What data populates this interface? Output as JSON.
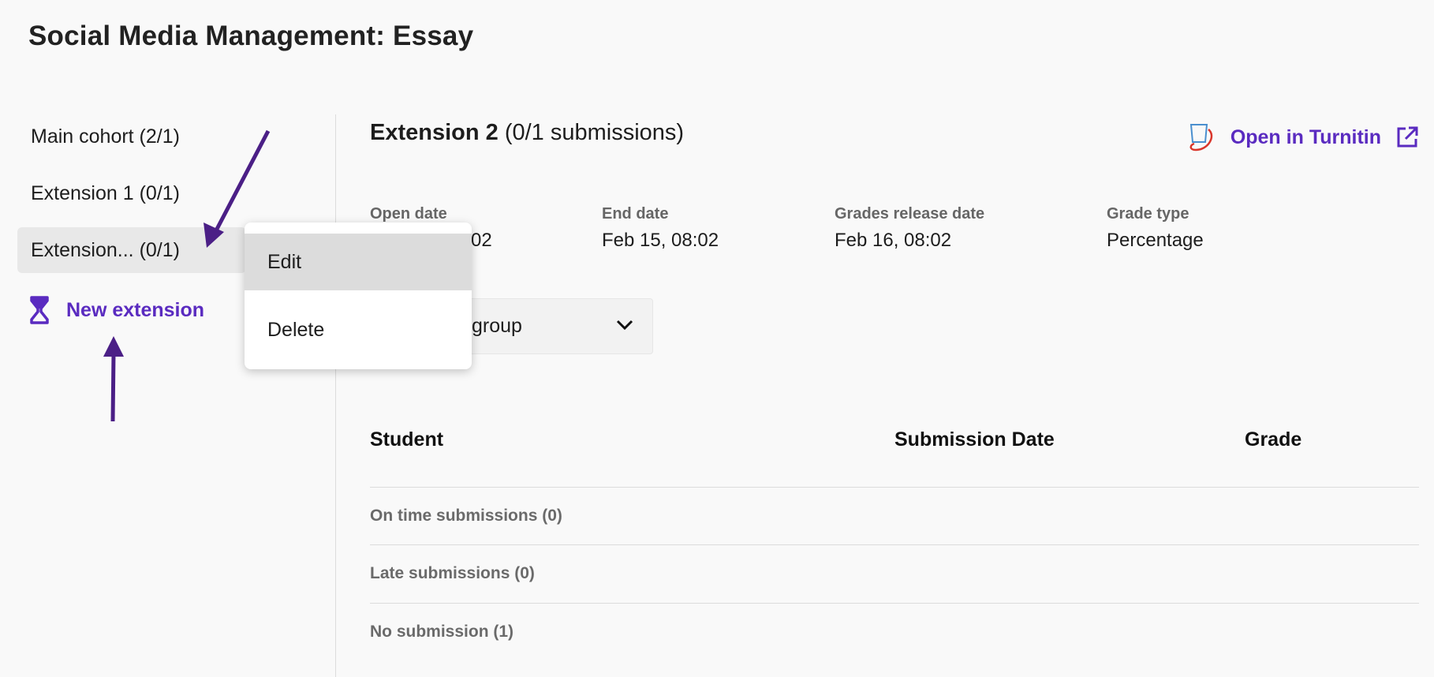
{
  "page": {
    "title": "Social Media Management: Essay"
  },
  "sidebar": {
    "items": [
      {
        "label": "Main cohort (2/1)"
      },
      {
        "label": "Extension 1 (0/1)"
      },
      {
        "label": "Extension... (0/1)",
        "active": true
      }
    ],
    "new_extension": {
      "label": "New extension",
      "icon": "hourglass-icon"
    }
  },
  "context_menu": {
    "items": [
      {
        "label": "Edit"
      },
      {
        "label": "Delete"
      }
    ]
  },
  "main": {
    "extension": {
      "name": "Extension 2",
      "submissions": "(0/1 submissions)"
    },
    "turnitin": {
      "label": "Open in Turnitin"
    },
    "meta": [
      {
        "label": "Open date",
        "value": "02"
      },
      {
        "label": "End date",
        "value": "Feb 15, 08:02"
      },
      {
        "label": "Grades release date",
        "value": "Feb 16, 08:02"
      },
      {
        "label": "Grade type",
        "value": "Percentage"
      }
    ],
    "group_select": {
      "label": "group"
    },
    "table": {
      "headers": {
        "student": "Student",
        "submission_date": "Submission Date",
        "grade": "Grade"
      },
      "sections": [
        {
          "label": "On time submissions (0)"
        },
        {
          "label": "Late submissions (0)"
        },
        {
          "label": "No submission (1)"
        }
      ]
    }
  },
  "colors": {
    "accent": "#5a2bc0",
    "arrow": "#4b1f86"
  }
}
